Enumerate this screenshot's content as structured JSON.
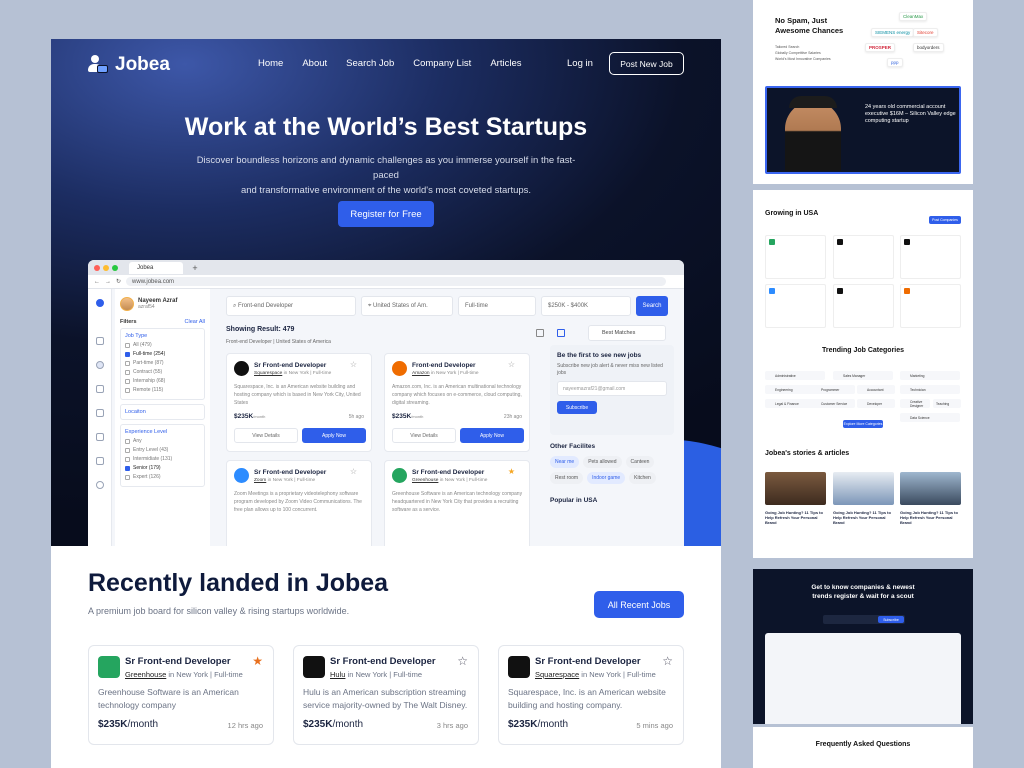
{
  "brand": "Jobea",
  "nav": [
    "Home",
    "About",
    "Search Job",
    "Company List",
    "Articles"
  ],
  "login": "Log in",
  "post_job": "Post New Job",
  "hero": {
    "title": "Work at the World’s Best Startups",
    "subtitle1": "Discover boundless horizons and dynamic challenges as you immerse yourself in the fast-paced",
    "subtitle2": "and transformative environment of the world's most coveted startups.",
    "cta": "Register for Free"
  },
  "browser": {
    "tab": "Jobea",
    "url": "www.jobea.com",
    "user_name": "Nayeem Azraf",
    "user_handle": "azraf54",
    "filters_label": "Filters",
    "clear_all": "Clear All",
    "job_type_label": "Job Type",
    "job_types": [
      "All (479)",
      "Full-time (254)",
      "Part-time (87)",
      "Contract (55)",
      "Internship (68)",
      "Remote (115)"
    ],
    "location_label": "Locaiton",
    "experience_label": "Experience Level",
    "experience": [
      "Any",
      "Entry Level (43)",
      "Intermidiate (131)",
      "Senior (179)",
      "Expert (126)"
    ],
    "search_value": "Front-end Developer",
    "location_value": "United States of Am.",
    "type_value": "Full-time",
    "salary_value": "$250K - $400K",
    "search_btn": "Search",
    "result": "Showing Result: 479",
    "crumb": "Front-end Developer  |  United States of America",
    "sort": "Best Matches",
    "view_details": "View Details",
    "apply_now": "Apply Now",
    "cards": [
      {
        "title": "Sr Front-end Developer",
        "company": "Squarespace",
        "meta": " in New York  |  Full-time",
        "desc": "Squarespace, Inc. is an American website building and hosting company which is based in New York City, United States",
        "salary": "$235K",
        "per": "/month",
        "ago": "5h ago",
        "color": "#111111"
      },
      {
        "title": "Front-end Developer",
        "company": "Amazon",
        "meta": " in New York  |  Full-time",
        "desc": "Amazon.com, Inc. is an American multinational technology company which focuses on e-commerce, cloud computing, digital streaming.",
        "salary": "$235K",
        "per": "/month",
        "ago": "23h ago",
        "color": "#ef6c00"
      },
      {
        "title": "Sr Front-end Developer",
        "company": "Zoom",
        "meta": " in New York  |  Full-time",
        "desc": "Zoom Meetings is a proprietary videotelephony software program developed by Zoom Video Communications. The free plan allows up to 100 concurrent.",
        "salary": "",
        "per": "",
        "ago": "",
        "color": "#2d8cff"
      },
      {
        "title": "Sr Front-end Developer",
        "company": "Greenhouse",
        "meta": " in New York  |  Full-time",
        "desc": "Greenhouse Software is an American technology company headquartered in New York City that provides a recruiting software as a service.",
        "salary": "",
        "per": "",
        "ago": "",
        "color": "#25a55f"
      }
    ],
    "alert_title": "Be the first to see new jobs",
    "alert_desc": "Subscribe new job alert & never miss new listed jobs",
    "alert_email": "nayeemazraf21@gmail.com",
    "subscribe": "Subscribe",
    "facilities_title": "Other Facilites",
    "facilities": [
      "Near me",
      "Pets allowed",
      "Canteen",
      "Rest room",
      "Indoor game",
      "Kitchen"
    ],
    "popular": "Popular in USA"
  },
  "recent": {
    "title": "Recently landed in Jobea",
    "subtitle": "A premium job board for silicon valley & rising startups worldwide.",
    "button": "All Recent Jobs",
    "cards": [
      {
        "title": "Sr Front-end Developer",
        "company": "Greenhouse",
        "meta": " in New York  |  Full-time",
        "desc": "Greenhouse Software is an American technology company",
        "salary": "$235K",
        "per": "/month",
        "ago": "12 hrs ago",
        "color": "#25a55f",
        "starred": true
      },
      {
        "title": "Sr Front-end Developer",
        "company": "Hulu",
        "meta": " in New York  |  Full-time",
        "desc": "Hulu is an American subscription streaming service majority-owned by The Walt Disney.",
        "salary": "$235K",
        "per": "/month",
        "ago": "3 hrs ago",
        "color": "#111111",
        "starred": false
      },
      {
        "title": "Sr Front-end Developer",
        "company": "Squarespace",
        "meta": " in New York  |  Full-time",
        "desc": "Squarespace, Inc. is an American website building and hosting company.",
        "salary": "$235K",
        "per": "/month",
        "ago": "5 mins ago",
        "color": "#111111",
        "starred": false
      }
    ]
  },
  "side": {
    "spam_title1": "No Spam, Just",
    "spam_title2": "Awesome Chances",
    "spam_list": [
      "Tailored Search",
      "Globally Competitive Salaries",
      "World's Most Innovative Companies"
    ],
    "logos": [
      "CleanMax",
      "SIEMENS energy",
      "Sitecore",
      "PROSPER",
      "bodyorders",
      "ppp"
    ],
    "testimonial": "24 years old commercial account executive $16M – Silicon Valley edge computing startup",
    "growing": "Growing in USA",
    "post_companies": "Post Companies",
    "trending": "Trending Job Categories",
    "categories": [
      "Administrative",
      "Sales Manager",
      "Marketing",
      "Engineering",
      "Programmer",
      "Accountant",
      "Technician",
      "Legal & Finance",
      "Customer Service",
      "Developer",
      "Creative Designer",
      "Teaching",
      "Data Science"
    ],
    "explore": "Explore More Categories",
    "stories_title": "Jobea's stories & articles",
    "stories": [
      "Going Job Hunting? 11 Tips to Help Refresh Your Personal Brand",
      "Going Job Hunting? 11 Tips to Help Refresh Your Personal Brand",
      "Going Job Hunting? 11 Tips to Help Refresh Your Personal Brand"
    ],
    "cta_title1": "Get to know companies & newest",
    "cta_title2": "trends register & wait for a scout",
    "subscribe": "Subscribe",
    "faq": "Frequently Asked Questions"
  }
}
